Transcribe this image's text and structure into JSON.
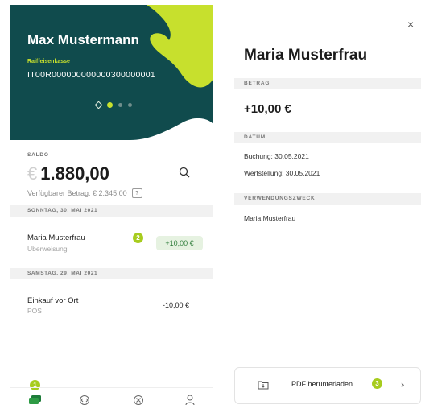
{
  "account_card": {
    "holder_name": "Max Mustermann",
    "bank_name": "Raiffeisenkasse",
    "iban": "IT00R000000000000300000001",
    "colors": {
      "dark": "#104b4d",
      "accent": "#c7e02d"
    }
  },
  "balance": {
    "label": "SALDO",
    "currency_symbol": "€",
    "amount": "1.880,00",
    "available_text": "Verfügbarer Betrag: € 2.345,00",
    "help_icon_label": "?"
  },
  "transactions": [
    {
      "date_header": "SONNTAG, 30. MAI 2021",
      "title": "Maria Musterfrau",
      "subtitle": "Überweisung",
      "amount": "+10,00 €",
      "badge": "2"
    },
    {
      "date_header": "SAMSTAG, 29. MAI 2021",
      "title": "Einkauf vor Ort",
      "subtitle": "POS",
      "amount": "-10,00 €"
    }
  ],
  "bottom_nav": {
    "badge": "1",
    "items": [
      "accounts-icon",
      "transfer-icon",
      "cards-icon",
      "profile-icon"
    ]
  },
  "detail": {
    "close_label": "×",
    "title": "Maria Musterfrau",
    "amount_header": "BETRAG",
    "amount": "+10,00 €",
    "date_header": "DATUM",
    "booking_date": "Buchung: 30.05.2021",
    "value_date": "Wertstellung: 30.05.2021",
    "purpose_header": "VERWENDUNGSZWECK",
    "purpose": "Maria Musterfrau",
    "pdf_button_label": "PDF herunterladen",
    "pdf_badge": "3",
    "chevron": "›"
  }
}
